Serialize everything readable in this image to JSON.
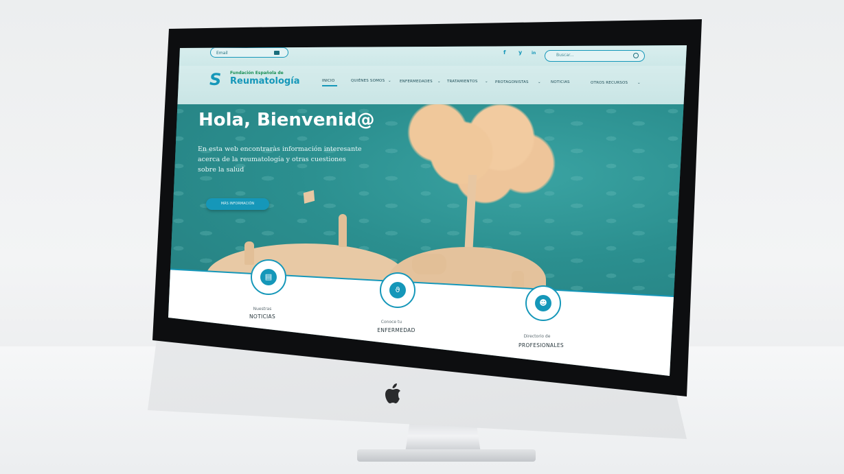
{
  "topbar": {
    "email_placeholder": "Email",
    "social": [
      "f",
      "y",
      "in"
    ],
    "search_placeholder": "Buscar..."
  },
  "logo": {
    "mark": "S",
    "line1": "Fundación Española de",
    "line2": "Reumatología"
  },
  "nav": {
    "items": [
      "INICIO",
      "QUIÉNES SOMOS",
      "ENFERMEDADES",
      "TRATAMIENTOS",
      "PROTAGONISTAS",
      "NOTICIAS",
      "OTROS RECURSOS"
    ]
  },
  "hero": {
    "title": "Hola, Bienvenid@",
    "text": "En esta web encontraràs información interesante acerca de la reumatología y otras cuestiones sobre la salud",
    "button": "MÁS INFORMACIÓN"
  },
  "features": [
    {
      "small": "Nuestras",
      "big": "NOTICIAS",
      "icon": "news-icon"
    },
    {
      "small": "Conoce tu",
      "big": "ENFERMEDAD",
      "icon": "stethoscope-icon"
    },
    {
      "small": "Directorio de",
      "big": "PROFESIONALES",
      "icon": "people-icon"
    }
  ],
  "colors": {
    "accent": "#1597b9",
    "hero_bg": "#2b8f8f"
  }
}
